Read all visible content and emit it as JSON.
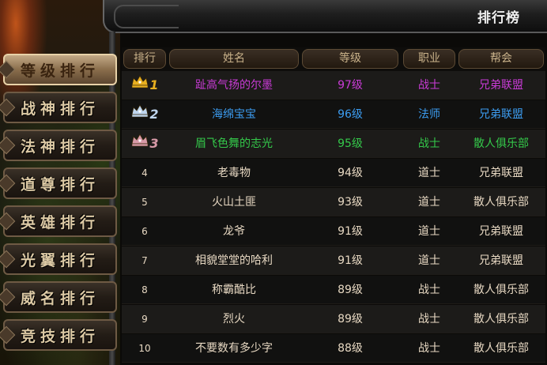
{
  "title": "排行榜",
  "nav": [
    {
      "label": "等级排行",
      "active": true
    },
    {
      "label": "战神排行",
      "active": false
    },
    {
      "label": "法神排行",
      "active": false
    },
    {
      "label": "道尊排行",
      "active": false
    },
    {
      "label": "英雄排行",
      "active": false
    },
    {
      "label": "光翼排行",
      "active": false
    },
    {
      "label": "威名排行",
      "active": false
    },
    {
      "label": "竞技排行",
      "active": false
    }
  ],
  "columns": [
    "排行",
    "姓名",
    "等级",
    "职业",
    "帮会"
  ],
  "rows": [
    {
      "rank": "1",
      "name": "趾高气扬的尔墨",
      "level": "97级",
      "job": "战士",
      "guild": "兄弟联盟",
      "icon": "gold-crown-icon"
    },
    {
      "rank": "2",
      "name": "海绵宝宝",
      "level": "96级",
      "job": "法师",
      "guild": "兄弟联盟",
      "icon": "silver-crown-icon"
    },
    {
      "rank": "3",
      "name": "眉飞色舞的志光",
      "level": "95级",
      "job": "战士",
      "guild": "散人俱乐部",
      "icon": "bronze-crown-icon"
    },
    {
      "rank": "4",
      "name": "老毒物",
      "level": "94级",
      "job": "道士",
      "guild": "兄弟联盟"
    },
    {
      "rank": "5",
      "name": "火山土匪",
      "level": "93级",
      "job": "道士",
      "guild": "散人俱乐部"
    },
    {
      "rank": "6",
      "name": "龙爷",
      "level": "91级",
      "job": "道士",
      "guild": "兄弟联盟"
    },
    {
      "rank": "7",
      "name": "相貌堂堂的哈利",
      "level": "91级",
      "job": "道士",
      "guild": "兄弟联盟"
    },
    {
      "rank": "8",
      "name": "称霸酷比",
      "level": "89级",
      "job": "战士",
      "guild": "散人俱乐部"
    },
    {
      "rank": "9",
      "name": "烈火",
      "level": "89级",
      "job": "战士",
      "guild": "散人俱乐部"
    },
    {
      "rank": "10",
      "name": "不要数有多少字",
      "level": "88级",
      "job": "战士",
      "guild": "散人俱乐部"
    }
  ],
  "colors": {
    "top1": "#c93bd6",
    "top2": "#3c9cf0",
    "top3": "#34c84a",
    "normal": "#e7d8c2",
    "gold": "#e8b020",
    "silver": "#bfd6ef",
    "bronze": "#d89aa8"
  }
}
